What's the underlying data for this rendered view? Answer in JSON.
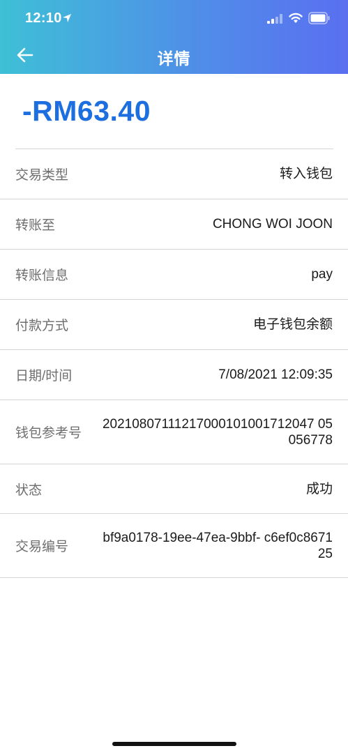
{
  "status_bar": {
    "time": "12:10"
  },
  "nav": {
    "title": "详情",
    "back_icon": "arrow-left-icon"
  },
  "amount": "-RM63.40",
  "details": [
    {
      "label": "交易类型",
      "value": "转入钱包"
    },
    {
      "label": "转账至",
      "value": "CHONG WOI JOON"
    },
    {
      "label": "转账信息",
      "value": "pay"
    },
    {
      "label": "付款方式",
      "value": "电子钱包余额"
    },
    {
      "label": "日期/时间",
      "value": "7/08/2021 12:09:35"
    },
    {
      "label": "钱包参考号",
      "value": "20210807111217000101001712047 05056778"
    },
    {
      "label": "状态",
      "value": "成功"
    },
    {
      "label": "交易编号",
      "value": "bf9a0178-19ee-47ea-9bbf- c6ef0c867125"
    }
  ],
  "colors": {
    "header_gradient_start": "#3ec0d6",
    "header_gradient_end": "#5a6ff0",
    "amount": "#1d6fe0",
    "label": "#6e6e6e",
    "divider": "#d6d6d6"
  }
}
